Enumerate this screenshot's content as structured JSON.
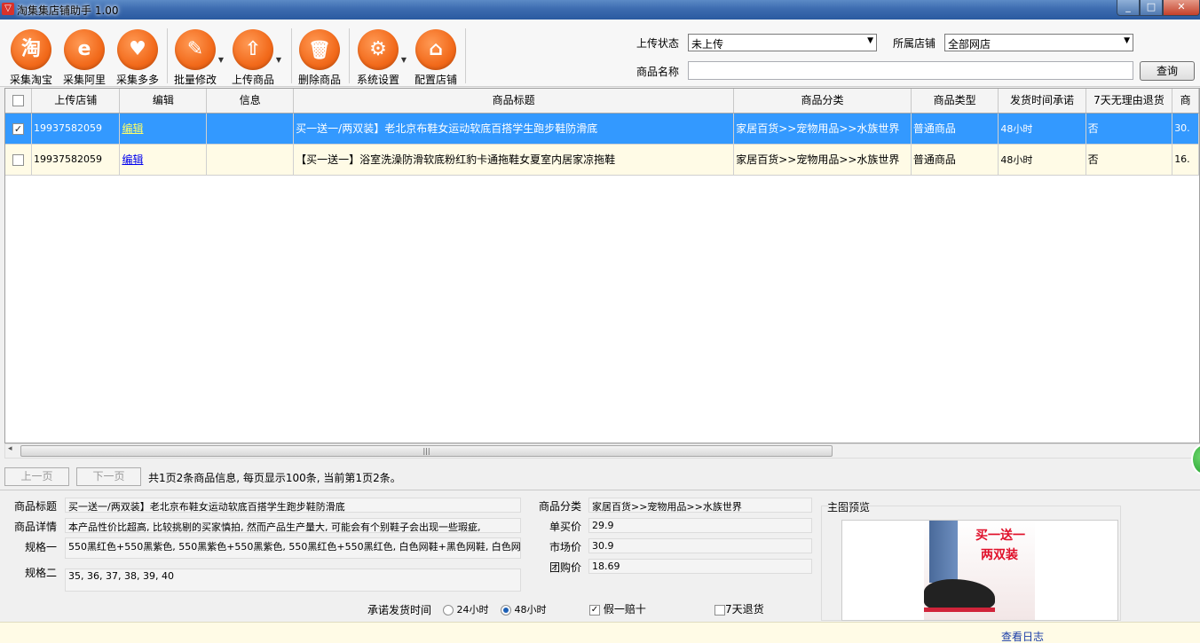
{
  "window": {
    "title": "淘集集店铺助手 1.00",
    "min": "_",
    "max": "□",
    "close": "✕"
  },
  "toolbar": {
    "buttons": [
      {
        "label": "采集淘宝",
        "glyph": "淘"
      },
      {
        "label": "采集阿里",
        "glyph": "e"
      },
      {
        "label": "采集多多",
        "glyph": "♥"
      },
      {
        "label": "批量修改",
        "glyph": "✎"
      },
      {
        "label": "上传商品",
        "glyph": "⇧"
      },
      {
        "label": "删除商品",
        "glyph": "🗑"
      },
      {
        "label": "系统设置",
        "glyph": "⚙"
      },
      {
        "label": "配置店铺",
        "glyph": "⌂"
      }
    ]
  },
  "filters": {
    "upload_status_label": "上传状态",
    "upload_status_value": "未上传",
    "shop_label": "所属店铺",
    "shop_value": "全部网店",
    "name_label": "商品名称",
    "name_value": "",
    "search_label": "查询"
  },
  "grid": {
    "columns": [
      "上传店铺",
      "编辑",
      "信息",
      "商品标题",
      "商品分类",
      "商品类型",
      "发货时间承诺",
      "7天无理由退货",
      "商"
    ],
    "rows": [
      {
        "shop": "19937582059",
        "edit": "编辑",
        "info": "",
        "title": "买一送一/两双装】老北京布鞋女运动软底百搭学生跑步鞋防滑底",
        "category": "家居百货>>宠物用品>>水族世界",
        "type": "普通商品",
        "ship": "48小时",
        "return7": "否",
        "price": "30.",
        "checked": true
      },
      {
        "shop": "19937582059",
        "edit": "编辑",
        "info": "",
        "title": "【买一送一】浴室洗澡防滑软底粉红豹卡通拖鞋女夏室内居家凉拖鞋",
        "category": "家居百货>>宠物用品>>水族世界",
        "type": "普通商品",
        "ship": "48小时",
        "return7": "否",
        "price": "16.",
        "checked": false
      }
    ]
  },
  "pager": {
    "prev": "上一页",
    "next": "下一页",
    "info": "共1页2条商品信息, 每页显示100条, 当前第1页2条。"
  },
  "detail": {
    "title_label": "商品标题",
    "title_value": "买一送一/两双装】老北京布鞋女运动软底百搭学生跑步鞋防滑底",
    "desc_label": "商品详情",
    "desc_value": "本产品性价比超高, 比较挑剔的买家慎拍, 然而产品生产量大, 可能会有个别鞋子会出现一些瑕疵,",
    "spec1_label": "规格一",
    "spec1_value": "550黑红色+550黑紫色, 550黑紫色+550黑紫色, 550黑红色+550黑红色, 白色网鞋+黑色网鞋, 白色网",
    "spec2_label": "规格二",
    "spec2_value": "35, 36, 37, 38, 39, 40",
    "category_label": "商品分类",
    "category_value": "家居百货>>宠物用品>>水族世界",
    "unit_price_label": "单买价",
    "unit_price_value": "29.9",
    "market_price_label": "市场价",
    "market_price_value": "30.9",
    "group_price_label": "团购价",
    "group_price_value": "18.69",
    "ship_label": "承诺发货时间",
    "ship_24": "24小时",
    "ship_48": "48小时",
    "fake_label": "假一赔十",
    "return_label": "7天退货",
    "preview_label": "主图预览",
    "preview_caption_1": "买一送一",
    "preview_caption_2": "两双装"
  },
  "status": {
    "log_link": "查看日志"
  },
  "colors": {
    "selected_row": "#3399ff",
    "row_bg": "#fffbe6",
    "accent_orange": "#f26a1b"
  }
}
